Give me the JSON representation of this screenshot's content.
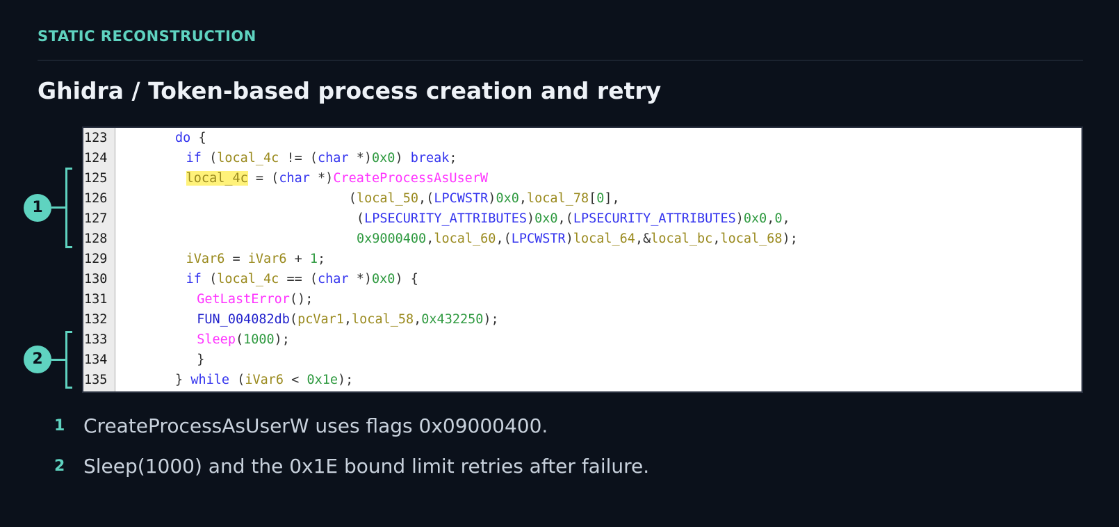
{
  "header": {
    "eyebrow": "STATIC RECONSTRUCTION",
    "title": "Ghidra / Token-based process creation and retry"
  },
  "code": {
    "lines": [
      {
        "num": "123",
        "indent": 5,
        "tokens": [
          [
            "kw",
            "do"
          ],
          [
            "pu",
            " {"
          ]
        ]
      },
      {
        "num": "124",
        "indent": 6,
        "tokens": [
          [
            "kw",
            "if"
          ],
          [
            "pu",
            " ("
          ],
          [
            "va",
            "local_4c"
          ],
          [
            "pu",
            " != ("
          ],
          [
            "ty",
            "char"
          ],
          [
            "pu",
            " *)"
          ],
          [
            "nu",
            "0x0"
          ],
          [
            "pu",
            ") "
          ],
          [
            "kw",
            "break"
          ],
          [
            "pu",
            ";"
          ]
        ]
      },
      {
        "num": "125",
        "indent": 6,
        "tokens": [
          [
            "hl",
            "local_4c"
          ],
          [
            "pu",
            " = ("
          ],
          [
            "ty",
            "char"
          ],
          [
            "pu",
            " *)"
          ],
          [
            "fn",
            "CreateProcessAsUserW"
          ]
        ]
      },
      {
        "num": "126",
        "indent": 21,
        "tokens": [
          [
            "pu",
            "("
          ],
          [
            "va",
            "local_50"
          ],
          [
            "pu",
            ",("
          ],
          [
            "ty",
            "LPCWSTR"
          ],
          [
            "pu",
            ")"
          ],
          [
            "nu",
            "0x0"
          ],
          [
            "pu",
            ","
          ],
          [
            "va",
            "local_78"
          ],
          [
            "pu",
            "["
          ],
          [
            "nu",
            "0"
          ],
          [
            "pu",
            "],"
          ]
        ]
      },
      {
        "num": "127",
        "indent": 21,
        "tokens": [
          [
            "pu",
            " ("
          ],
          [
            "ty",
            "LPSECURITY_ATTRIBUTES"
          ],
          [
            "pu",
            ")"
          ],
          [
            "nu",
            "0x0"
          ],
          [
            "pu",
            ",("
          ],
          [
            "ty",
            "LPSECURITY_ATTRIBUTES"
          ],
          [
            "pu",
            ")"
          ],
          [
            "nu",
            "0x0"
          ],
          [
            "pu",
            ","
          ],
          [
            "nu",
            "0"
          ],
          [
            "pu",
            ","
          ]
        ]
      },
      {
        "num": "128",
        "indent": 21,
        "tokens": [
          [
            "pu",
            " "
          ],
          [
            "nu",
            "0x9000400"
          ],
          [
            "pu",
            ","
          ],
          [
            "va",
            "local_60"
          ],
          [
            "pu",
            ",("
          ],
          [
            "ty",
            "LPCWSTR"
          ],
          [
            "pu",
            ")"
          ],
          [
            "va",
            "local_64"
          ],
          [
            "pu",
            ",&"
          ],
          [
            "va",
            "local_bc"
          ],
          [
            "pu",
            ","
          ],
          [
            "va",
            "local_68"
          ],
          [
            "pu",
            ");"
          ]
        ]
      },
      {
        "num": "129",
        "indent": 6,
        "tokens": [
          [
            "va",
            "iVar6"
          ],
          [
            "pu",
            " = "
          ],
          [
            "va",
            "iVar6"
          ],
          [
            "pu",
            " + "
          ],
          [
            "nu",
            "1"
          ],
          [
            "pu",
            ";"
          ]
        ]
      },
      {
        "num": "130",
        "indent": 6,
        "tokens": [
          [
            "kw",
            "if"
          ],
          [
            "pu",
            " ("
          ],
          [
            "va",
            "local_4c"
          ],
          [
            "pu",
            " == ("
          ],
          [
            "ty",
            "char"
          ],
          [
            "pu",
            " *)"
          ],
          [
            "nu",
            "0x0"
          ],
          [
            "pu",
            ") {"
          ]
        ]
      },
      {
        "num": "131",
        "indent": 7,
        "tokens": [
          [
            "fn",
            "GetLastError"
          ],
          [
            "pu",
            "();"
          ]
        ]
      },
      {
        "num": "132",
        "indent": 7,
        "tokens": [
          [
            "fu",
            "FUN_004082db"
          ],
          [
            "pu",
            "("
          ],
          [
            "va",
            "pcVar1"
          ],
          [
            "pu",
            ","
          ],
          [
            "va",
            "local_58"
          ],
          [
            "pu",
            ","
          ],
          [
            "nu",
            "0x432250"
          ],
          [
            "pu",
            ");"
          ]
        ]
      },
      {
        "num": "133",
        "indent": 7,
        "tokens": [
          [
            "fn",
            "Sleep"
          ],
          [
            "pu",
            "("
          ],
          [
            "nu",
            "1000"
          ],
          [
            "pu",
            ");"
          ]
        ]
      },
      {
        "num": "134",
        "indent": 7,
        "tokens": [
          [
            "pu",
            "}"
          ]
        ]
      },
      {
        "num": "135",
        "indent": 5,
        "tokens": [
          [
            "pu",
            "} "
          ],
          [
            "kw",
            "while"
          ],
          [
            "pu",
            " ("
          ],
          [
            "va",
            "iVar6"
          ],
          [
            "pu",
            " < "
          ],
          [
            "nu",
            "0x1e"
          ],
          [
            "pu",
            ");"
          ]
        ]
      }
    ]
  },
  "callouts": [
    {
      "label": "1"
    },
    {
      "label": "2"
    }
  ],
  "notes": [
    {
      "num": "1",
      "text": "CreateProcessAsUserW uses flags 0x09000400."
    },
    {
      "num": "2",
      "text": "Sleep(1000) and the 0x1E bound limit retries after failure."
    }
  ]
}
